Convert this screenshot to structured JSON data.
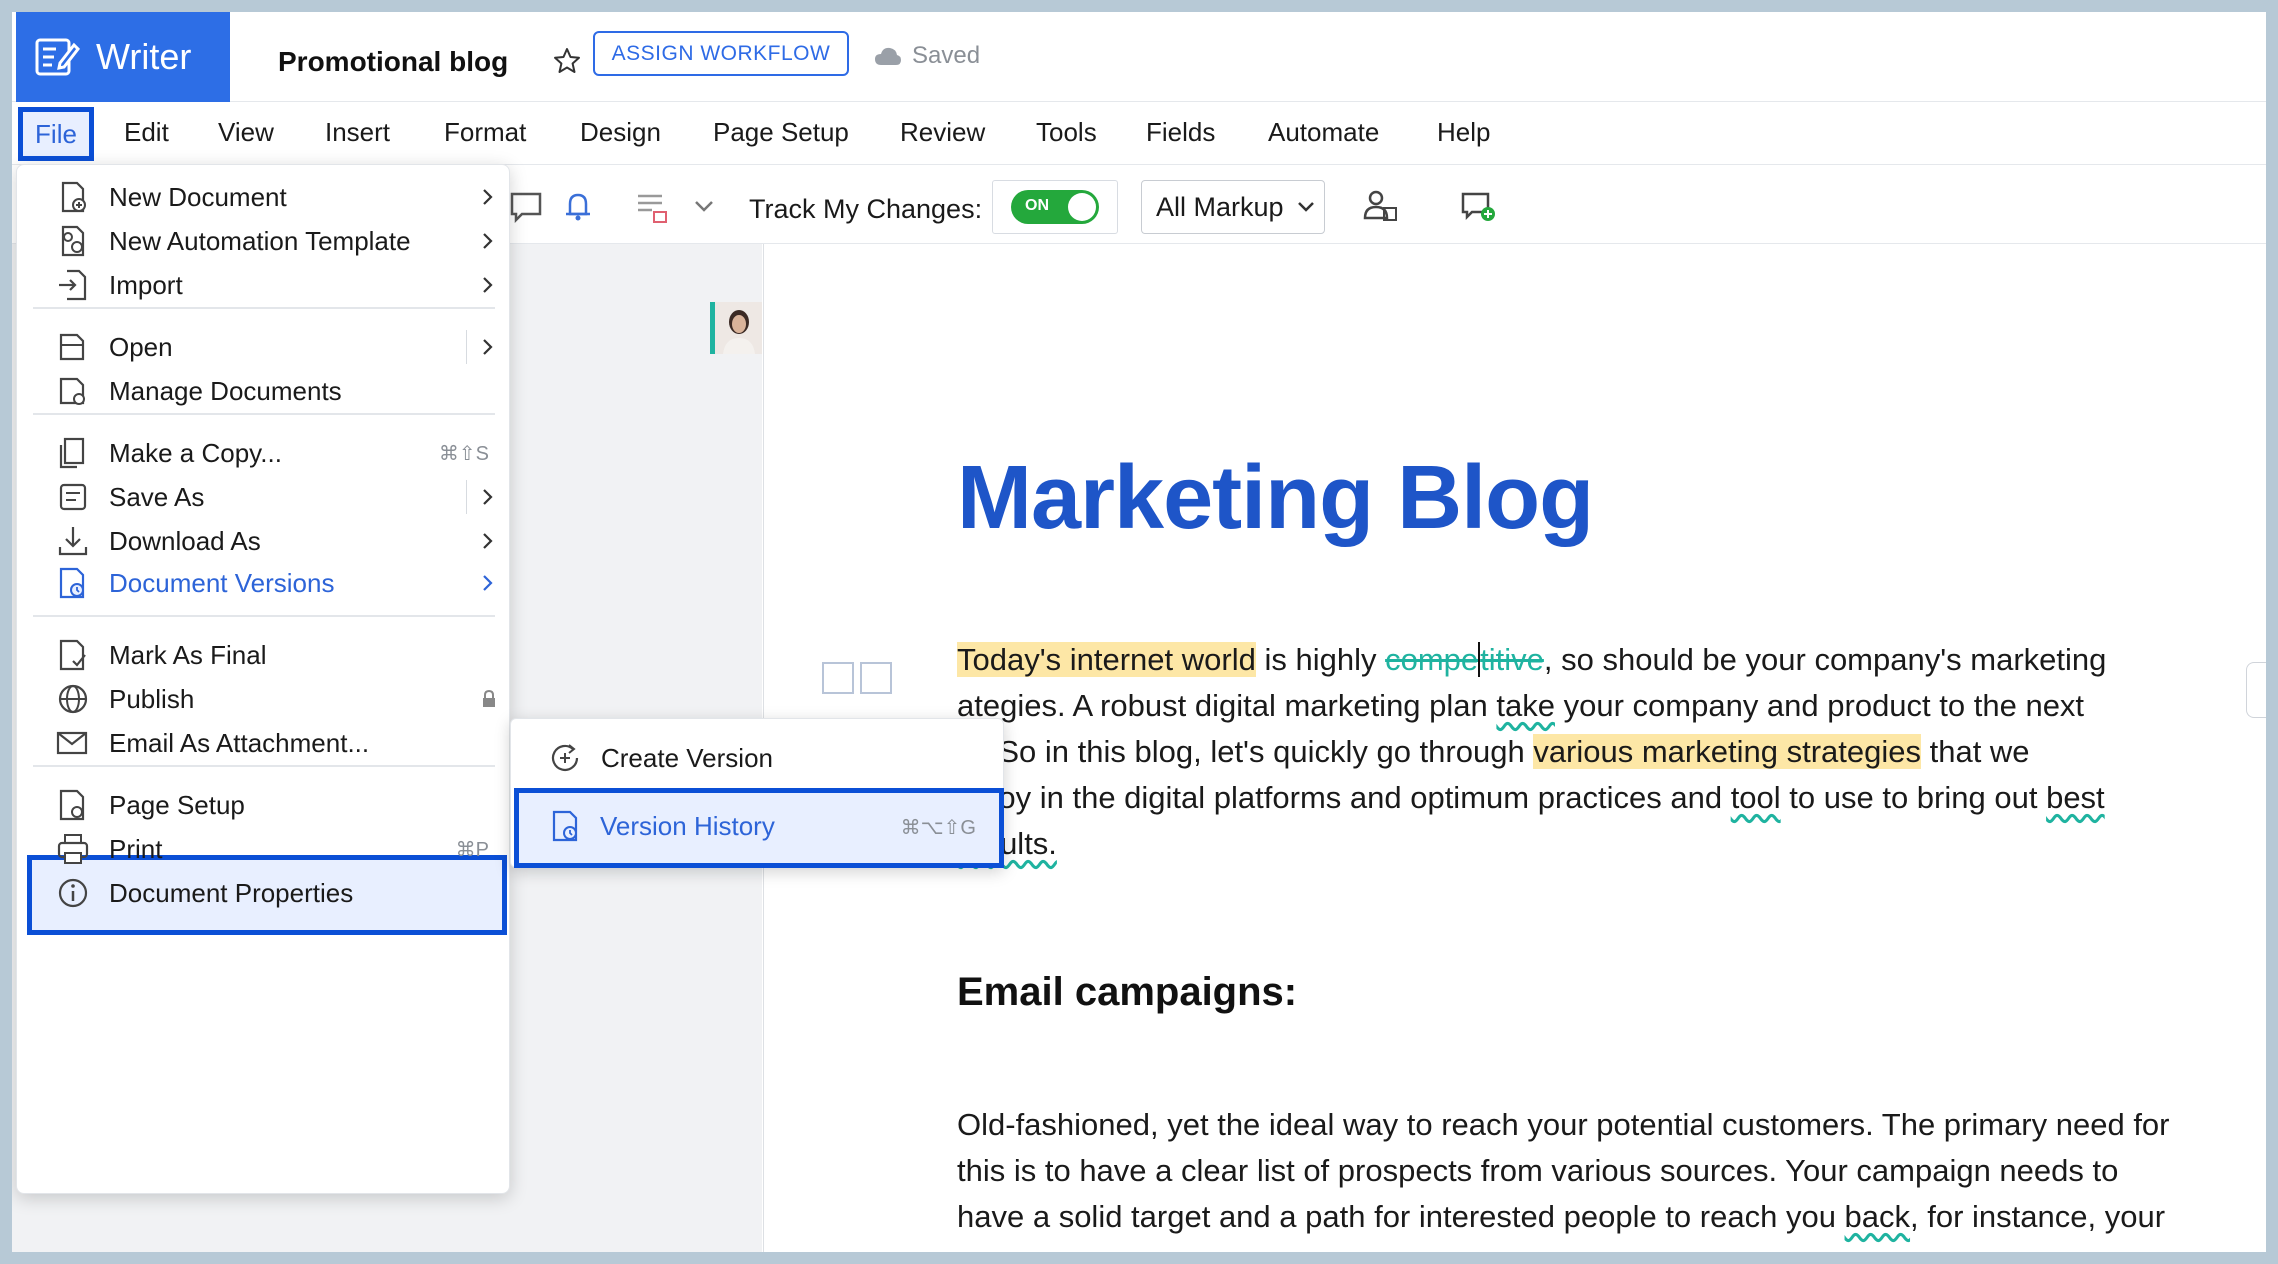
{
  "app": {
    "name": "Writer",
    "doc_title": "Promotional blog",
    "assign_workflow": "ASSIGN WORKFLOW",
    "save_status": "Saved"
  },
  "menubar": [
    "File",
    "Edit",
    "View",
    "Insert",
    "Format",
    "Design",
    "Page Setup",
    "Review",
    "Tools",
    "Fields",
    "Automate",
    "Help"
  ],
  "toolbar": {
    "track_label": "Track My Changes:",
    "toggle_state": "ON",
    "markup_value": "All Markup"
  },
  "file_menu": {
    "new_document": "New Document",
    "new_automation_template": "New Automation Template",
    "import": "Import",
    "open": "Open",
    "manage_documents": "Manage Documents",
    "make_copy": "Make a Copy...",
    "make_copy_shortcut": "⌘⇧S",
    "save_as": "Save As",
    "download_as": "Download As",
    "document_versions": "Document Versions",
    "mark_as_final": "Mark As Final",
    "publish": "Publish",
    "email_as_attachment": "Email As Attachment...",
    "page_setup": "Page Setup",
    "print": "Print",
    "print_shortcut": "⌘P",
    "document_properties": "Document Properties"
  },
  "versions_submenu": {
    "create_version": "Create Version",
    "version_history": "Version History",
    "version_history_shortcut": "⌘⌥⇧G"
  },
  "document": {
    "heading": "Marketing Blog",
    "p1": {
      "hl1": "Today's internet world",
      "t1": " is highly ",
      "strike": "compe",
      "strike2": "titive",
      "t2": ", so should be your company's marketing",
      "line2": "ategies. A robust digital marketing plan ",
      "line2_wavy": "take",
      "line2_end": " your company and product to the next",
      "line3a": "el. So in this blog, let's quickly go through ",
      "line3_hl": "various marketing strategies",
      "line3b": " that we",
      "line4a": "nploy in the digital platforms and optimum practices and ",
      "line4_wavy1": "tool",
      "line4b": " to use to bring out ",
      "line4_wavy2": "best",
      "line5": "results."
    },
    "subheading": "Email campaigns:",
    "p2": {
      "line1": "Old-fashioned, yet the ideal way to reach your potential customers. The primary need for",
      "line2": "this is to have a clear list of prospects from various sources. Your campaign needs to",
      "line3a": "have a solid target and a path for interested people to reach you ",
      "line3_wavy": "back",
      "line3b": ", for instance, your"
    }
  },
  "colors": {
    "brand": "#2d6ee6",
    "highlight_border": "#0b4fd6",
    "heading": "#1e55c8",
    "toggle_on": "#24a83c",
    "track_change": "#1fb3a0",
    "text_highlight": "#fde7a6"
  }
}
